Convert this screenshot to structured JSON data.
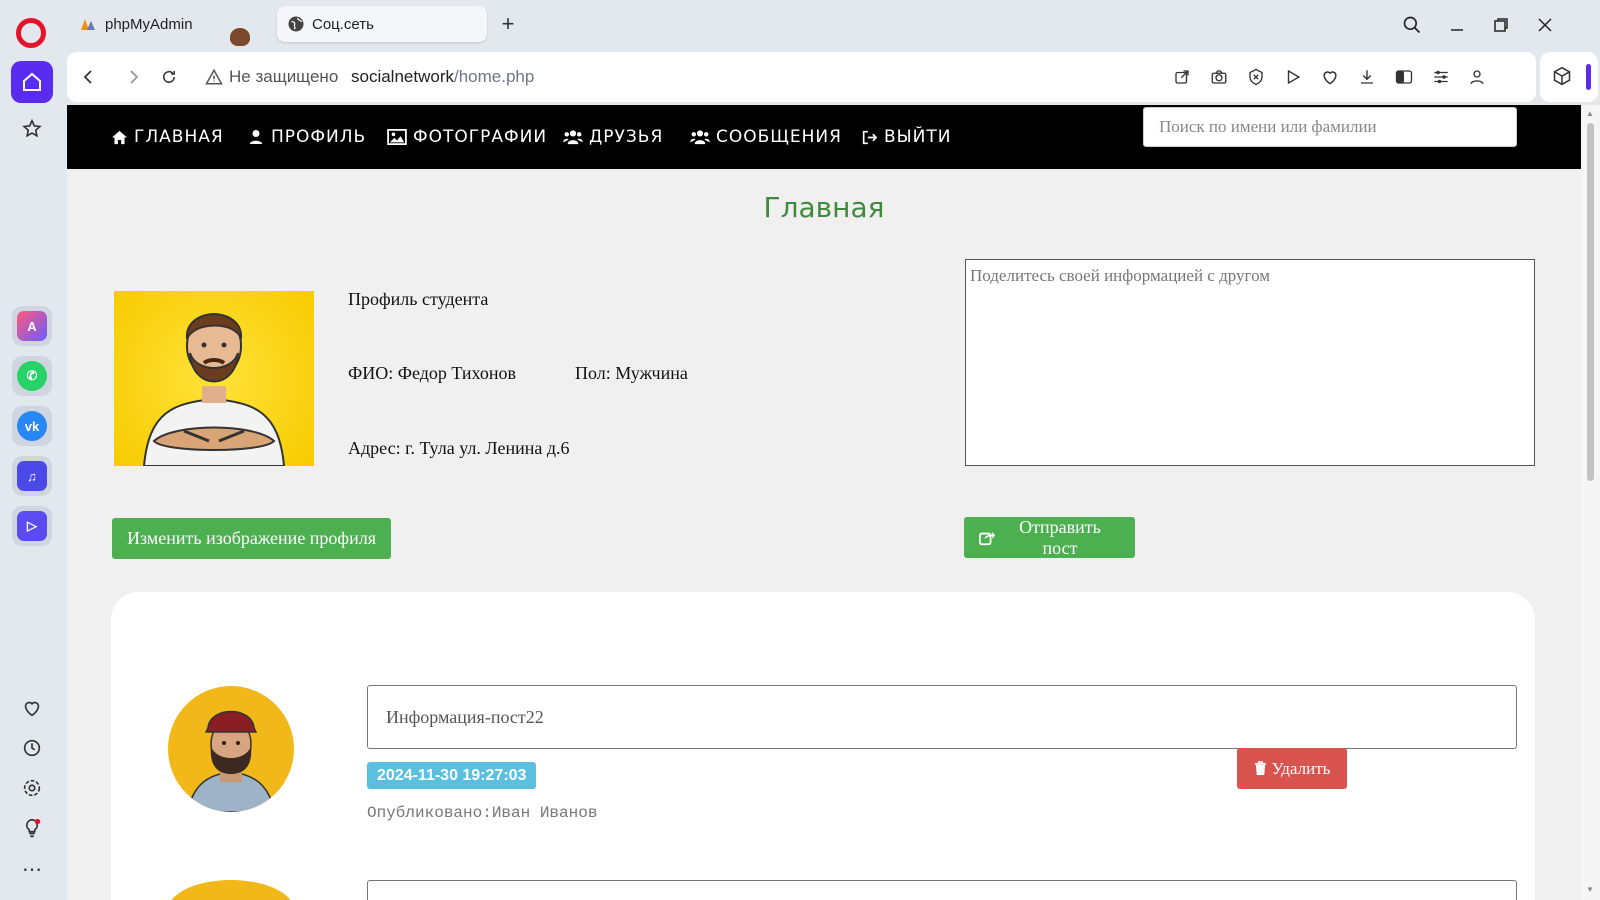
{
  "tabs": [
    {
      "title": "phpMyAdmin",
      "favicon": "pma-icon"
    },
    {
      "title": "Соц.сеть",
      "favicon": "globe-icon"
    }
  ],
  "address": {
    "security_label": "Не защищено",
    "host": "socialnetwork",
    "path": "/home.php"
  },
  "site_nav": {
    "items": [
      {
        "label": "ГЛАВНАЯ",
        "icon": "home-icon"
      },
      {
        "label": "ПРОФИЛЬ",
        "icon": "user-icon"
      },
      {
        "label": "ФОТОГРАФИИ",
        "icon": "image-icon"
      },
      {
        "label": "ДРУЗЬЯ",
        "icon": "users-icon"
      },
      {
        "label": "СООБЩЕНИЯ",
        "icon": "users-icon"
      },
      {
        "label": "ВЫЙТИ",
        "icon": "sign-out-icon"
      }
    ],
    "search_placeholder": "Поиск по имени или фамилии"
  },
  "page": {
    "title": "Главная",
    "profile": {
      "heading": "Профиль студента",
      "name": "ФИО: Федор Тихонов",
      "gender": "Пол: Мужчина",
      "address": "Адрес: г. Тула ул. Ленина д.6"
    },
    "change_avatar_label": "Изменить изображение профиля",
    "post_placeholder": "Поделитесь своей информацией с другом",
    "send_post_label": "Отправить пост"
  },
  "posts": [
    {
      "content": "Информация-пост22",
      "date": "2024-11-30 19:27:03",
      "author": "Опубликовано:Иван Иванов",
      "delete_label": "Удалить"
    }
  ],
  "colors": {
    "nav_bg": "#000000",
    "title_green": "#3f8a3f",
    "button_green": "#4caf50",
    "date_badge": "#5bc0de",
    "delete_red": "#d9534f",
    "opera_accent": "#5a2cf0"
  }
}
